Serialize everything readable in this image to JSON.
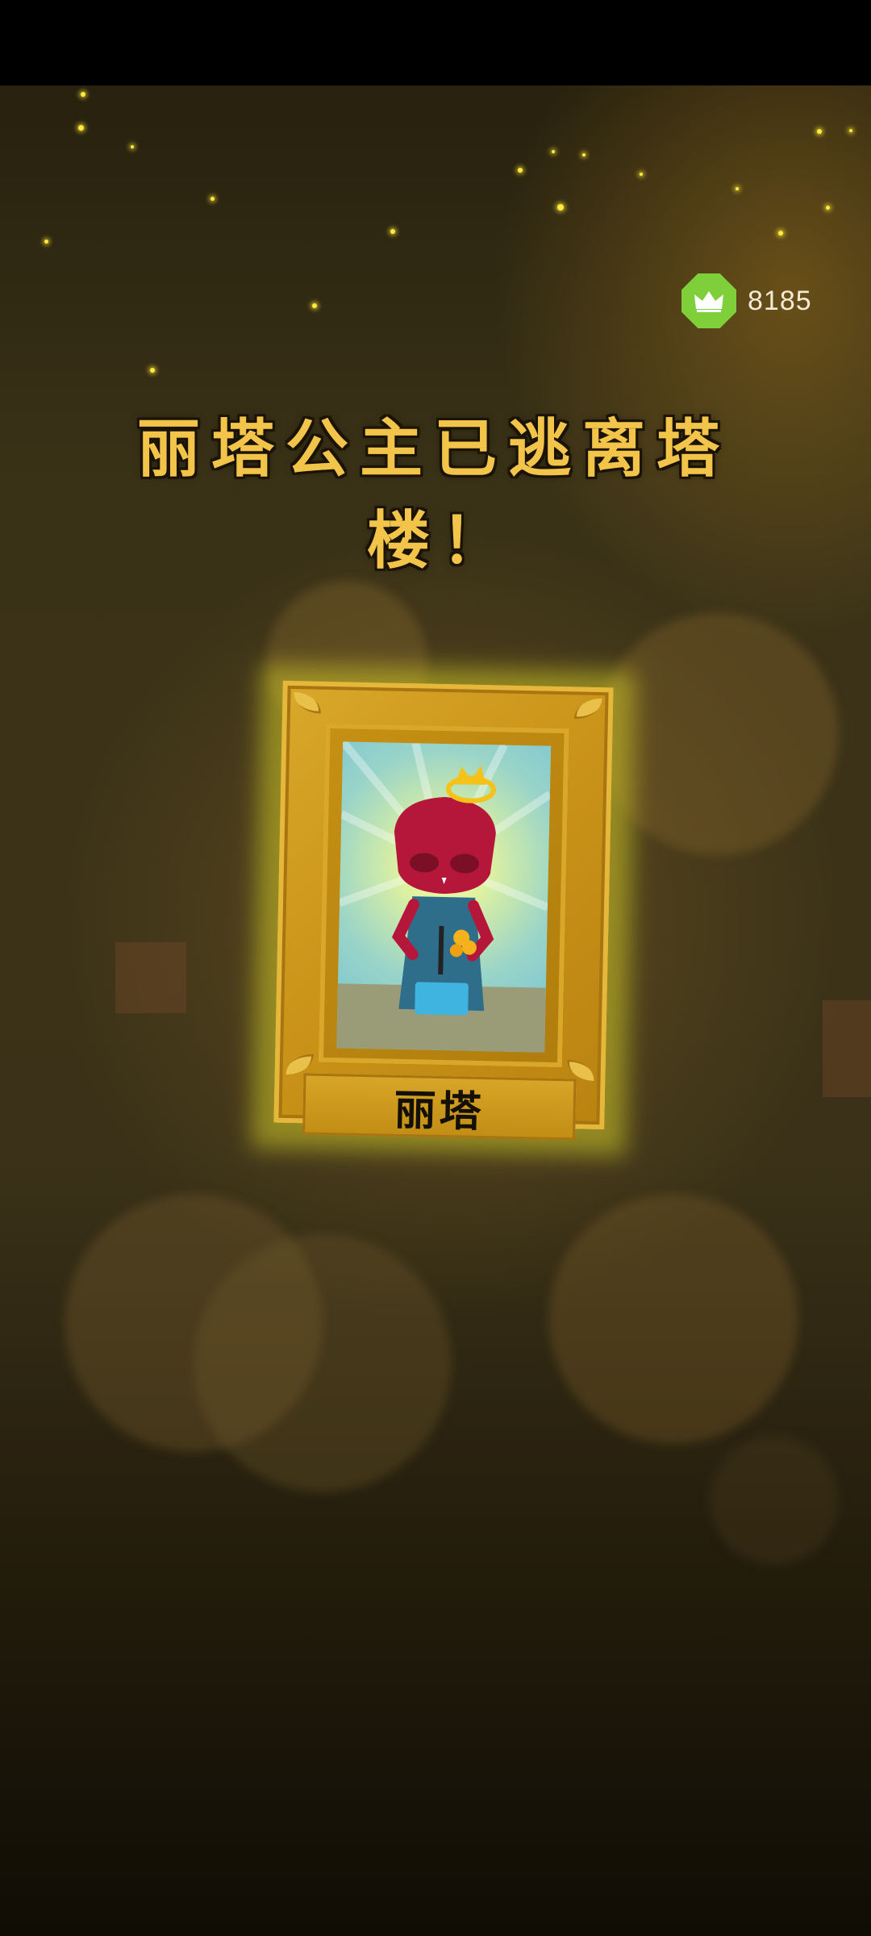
{
  "hud": {
    "score": "8185",
    "score_icon": "crown-icon",
    "badge_color": "#7fcf3a"
  },
  "message": {
    "line1": "丽塔公主已逃离塔",
    "line2": "楼！"
  },
  "card": {
    "name": "丽塔",
    "frame_color": "#c99218",
    "glow_color": "#d2c828"
  }
}
